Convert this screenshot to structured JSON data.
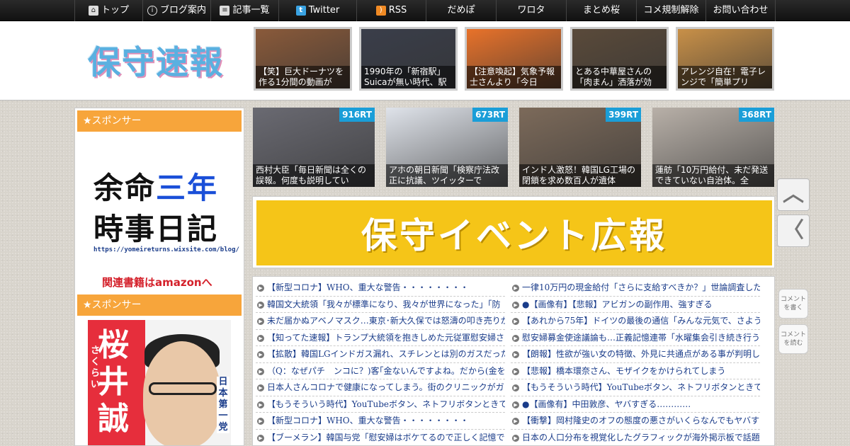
{
  "nav": [
    {
      "label": "トップ",
      "icon": "home-icon"
    },
    {
      "label": "ブログ案内",
      "icon": "info-icon"
    },
    {
      "label": "記事一覧",
      "icon": "list-icon"
    },
    {
      "label": "Twitter",
      "icon": "twitter-icon"
    },
    {
      "label": "RSS",
      "icon": "rss-icon"
    },
    {
      "label": "だめぽ"
    },
    {
      "label": "ワロタ"
    },
    {
      "label": "まとめ桜"
    },
    {
      "label": "コメ規制解除"
    },
    {
      "label": "お問い合わせ"
    }
  ],
  "header": {
    "logo": "保守速報",
    "thumbs": [
      {
        "caption": "【笑】巨大ドーナツを作る1分間の動画が",
        "bg": "#8a5a3a"
      },
      {
        "caption": "1990年の「新宿駅」Suicaが無い時代、駅",
        "bg": "#3a3e4a"
      },
      {
        "caption": "【注意喚起】気象予報士さんより「今日",
        "bg": "#e8722a"
      },
      {
        "caption": "とある中華屋さんの「肉まん」洒落が効",
        "bg": "#5a4a3a"
      },
      {
        "caption": "アレンジ自在！電子レンジで「簡単プリ",
        "bg": "#c89048"
      }
    ]
  },
  "sidebar": {
    "sponsor_label_1": "★スポンサー",
    "sponsor_label_2": "★スポンサー",
    "ad1": {
      "line1_a": "余命",
      "line1_b": "三年",
      "line2": "時事日記",
      "url": "https://yomeireturns.wixsite.com/blog/",
      "amazon": "関連書籍はamazonへ"
    },
    "ad2": {
      "name": "桜井誠",
      "kana": "さくらい",
      "side": "日本第一党"
    }
  },
  "rt_items": [
    {
      "count": "916RT",
      "caption": "西村大臣「毎日新聞は全くの誤報。何度も説明してい",
      "bg": "#6a6a72"
    },
    {
      "count": "673RT",
      "caption": "アホの朝日新聞「検察庁法改正に抗議、ツイッターで",
      "bg": "#dfe3ea"
    },
    {
      "count": "399RT",
      "caption": "インド人激怒！韓国LG工場の閉鎖を求め数百人が遺体",
      "bg": "#7c6a5a"
    },
    {
      "count": "368RT",
      "caption": "蓮舫「10万円給付、未だ発送できていない自治体。全",
      "bg": "#b8b0a8"
    }
  ],
  "banner": {
    "text": "保守イベント広報"
  },
  "links_left": [
    "【新型コロナ】WHO、重大な警告・・・・・・・・",
    "韓国文大統領「我々が標準になり、我々が世界になった」「防",
    "未だ届かぬアベノマスク…東京･新大久保では怒濤の叩き売りが",
    "【知ってた速報】トランプ大統領を抱きしめた元従軍慰安婦さ",
    "【拡散】韓国LGインドガス漏れ、スチレンとは別のガスだった",
    "（Q：なぜパチ　ンコに？)客｢金ないんですよね。だから(金を)",
    "日本人さんコロナで健康になってしまう。街のクリニックがガ",
    "【もうそういう時代】YouTubeボタン、ネトフリボタンときて、",
    "【新型コロナ】WHO、重大な警告・・・・・・・・",
    "【ブーメラン】韓国与党「慰安婦はボケてるので正しく記憶で"
  ],
  "links_right": [
    "一律10万円の現金給付「さらに支給すべきか？」世論調査した",
    "●【画像有】【悲報】アビガンの副作用、強すぎる",
    "【あれから75年】ドイツの最後の通信「みんな元気で、さよう",
    "慰安婦募金使途議論も…正義記憶連帯「水曜集会引き続き行う",
    "【朗報】性欲が強い女の特徴、外見に共通点がある事が判明し",
    "【悲報】橋本環奈さん、モザイクをかけられてしまう",
    "【もうそういう時代】YouTubeボタン、ネトフリボタンときて、",
    "●【画像有】中田敦彦、ヤバすぎる…………",
    "【衝撃】岡村隆史のオフの態度の悪さがいくらなんでもヤバす",
    "日本の人口分布を視覚化したグラフィックが海外掲示板で話題"
  ],
  "side_buttons": {
    "comment_write": "コメントを書く",
    "comment_read": "コメントを読む"
  },
  "colors": {
    "accent_orange": "#f7a53b",
    "rt_badge": "#1a9ed8",
    "banner_yellow": "#f5c518",
    "link_blue": "#1a3c8a"
  }
}
